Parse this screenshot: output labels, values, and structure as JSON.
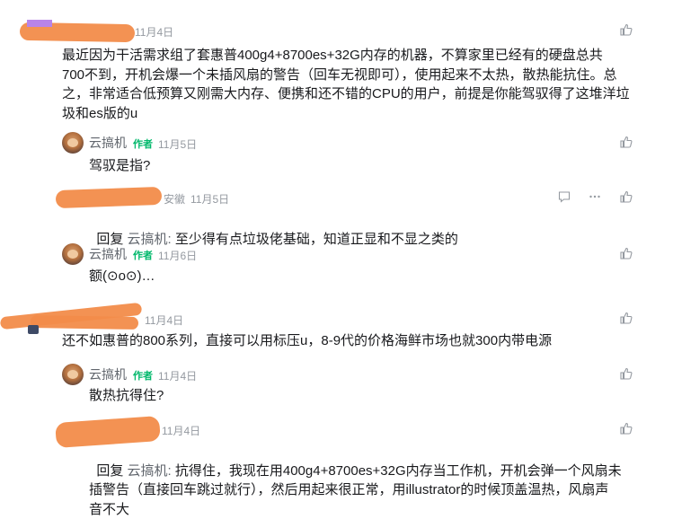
{
  "comments": [
    {
      "date": "11月4日",
      "text": "最近因为干活需求组了套惠普400g4+8700es+32G内存的机器，不算家里已经有的硬盘总共\n700不到，开机会爆一个未插风扇的警告（回车无视即可），使用起来不太热，散热能抗住。总\n之，非常适合低预算又刚需大内存、便携和还不错的CPU的用户，前提是你能驾驭得了这堆洋垃\n圾和es版的u",
      "replies": [
        {
          "name": "云搞机",
          "badge": "作者",
          "date": "11月5日",
          "text": "驾驭是指?"
        },
        {
          "location": "安徽",
          "date": "11月5日",
          "reply_prefix": "回复 ",
          "reply_target": "云搞机:",
          "text": " 至少得有点垃圾佬基础，知道正显和不显之类的"
        },
        {
          "name": "云搞机",
          "badge": "作者",
          "date": "11月6日",
          "text": "额(⊙o⊙)…"
        }
      ]
    },
    {
      "date": "11月4日",
      "text": "还不如惠普的800系列，直接可以用标压u，8-9代的价格海鲜市场也就300内带电源",
      "replies": [
        {
          "name": "云搞机",
          "badge": "作者",
          "date": "11月4日",
          "text": "散热抗得住?"
        },
        {
          "date": "11月4日",
          "reply_prefix": "回复 ",
          "reply_target": "云搞机:",
          "text": " 抗得住，我现在用400g4+8700es+32G内存当工作机，开机会弹一个风扇未\n插警告（直接回车跳过就行），然后用起来很正常，用illustrator的时候顶盖温热，风扇声\n音不大"
        }
      ]
    }
  ],
  "icons": [
    "like-icon",
    "comment-icon",
    "more-icon"
  ],
  "colors": {
    "text": "#18191c",
    "meta": "#9499a0",
    "badge": "#00b86b",
    "redaction": "#f28c4a"
  }
}
